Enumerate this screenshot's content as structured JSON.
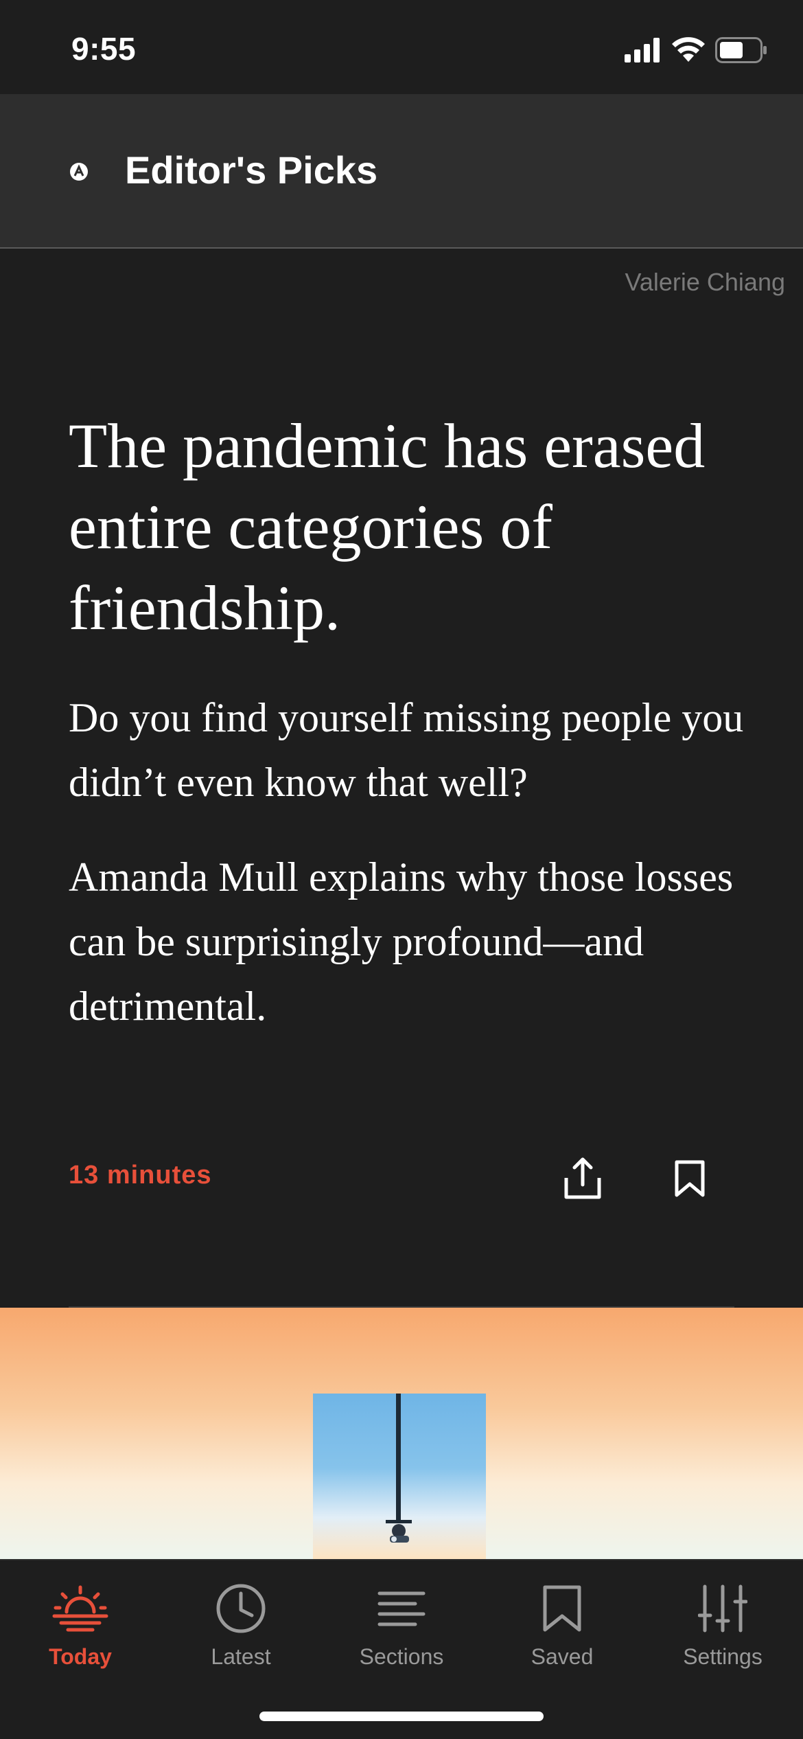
{
  "status_bar": {
    "time": "9:55",
    "icons": [
      "cellular-signal-icon",
      "wifi-icon",
      "battery-icon"
    ]
  },
  "header": {
    "title": "Editor's Picks",
    "logo_icon": "atlantic-logo-icon"
  },
  "article": {
    "photo_credit": "Valerie Chiang",
    "headline": "The pandemic has erased entire categories of friendship.",
    "dek_1": "Do you find yourself missing people you didn’t even know that well?",
    "dek_2": "Amanda Mull explains why those losses can be surprisingly profound—and detrimental.",
    "read_time": "13 minutes",
    "actions": [
      "share-icon",
      "bookmark-icon"
    ]
  },
  "tab_bar": {
    "active": "today",
    "tabs": [
      {
        "id": "today",
        "label": "Today",
        "icon": "sunrise-icon"
      },
      {
        "id": "latest",
        "label": "Latest",
        "icon": "clock-icon"
      },
      {
        "id": "sections",
        "label": "Sections",
        "icon": "lines-icon"
      },
      {
        "id": "saved",
        "label": "Saved",
        "icon": "bookmark-icon"
      },
      {
        "id": "settings",
        "label": "Settings",
        "icon": "sliders-icon"
      }
    ]
  },
  "colors": {
    "background": "#1e1e1e",
    "header": "#2e2e2e",
    "accent": "#e8503a",
    "muted": "#9a9a9a"
  }
}
